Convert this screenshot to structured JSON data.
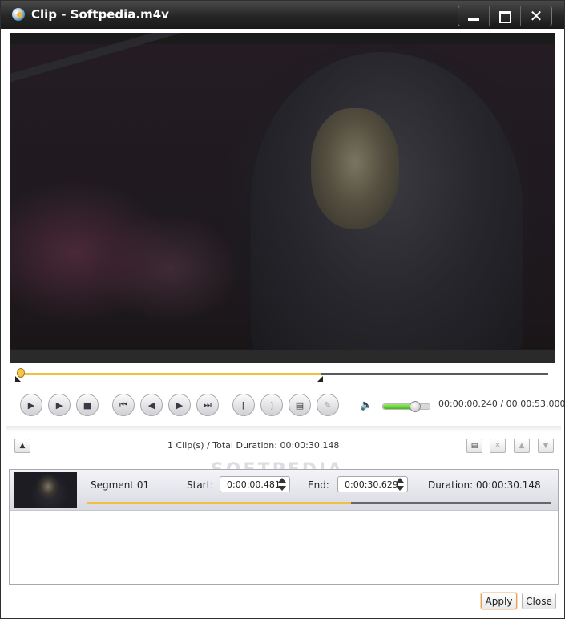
{
  "window": {
    "title": "Clip - Softpedia.m4v",
    "minimize_icon": "minimize-icon",
    "maximize_icon": "maximize-icon",
    "close_icon": "close-icon",
    "close_glyph": "✕"
  },
  "player": {
    "seek_progress": 0.573,
    "segment_end_fraction": 0.573,
    "controls": [
      {
        "name": "play-button",
        "icon": "play-icon",
        "glyph": "▶"
      },
      {
        "name": "play-segment-button",
        "icon": "play-segment-icon",
        "glyph": "▶"
      },
      {
        "name": "stop-button",
        "icon": "stop-icon",
        "glyph": "■"
      },
      {
        "name": "skip-to-start-button",
        "icon": "skip-start-icon",
        "glyph": "⏮"
      },
      {
        "name": "step-back-button",
        "icon": "step-back-icon",
        "glyph": "◀"
      },
      {
        "name": "step-forward-button",
        "icon": "step-forward-icon",
        "glyph": "▶"
      },
      {
        "name": "skip-to-end-button",
        "icon": "skip-end-icon",
        "glyph": "⏭"
      },
      {
        "name": "set-start-button",
        "icon": "bracket-open-icon",
        "glyph": "["
      },
      {
        "name": "set-end-button",
        "icon": "bracket-close-icon",
        "glyph": "]"
      },
      {
        "name": "add-clip-button",
        "icon": "add-document-icon",
        "glyph": "▤"
      },
      {
        "name": "edit-button",
        "icon": "pencil-icon",
        "glyph": "✎"
      }
    ],
    "volume_icon": "speaker-icon",
    "volume_glyph": "🔈",
    "volume_level": 0.68,
    "time_display": "00:00:00.240 / 00:00:53.000"
  },
  "clip_bar": {
    "collapse_icon": "triangle-up-icon",
    "collapse_glyph": "▲",
    "summary": "1 Clip(s) /  Total Duration: 00:00:30.148",
    "actions": [
      {
        "name": "new-clip-button",
        "icon": "new-document-icon",
        "glyph": "▤"
      },
      {
        "name": "delete-clip-button",
        "icon": "x-icon",
        "glyph": "✕"
      },
      {
        "name": "move-up-button",
        "icon": "triangle-up-icon",
        "glyph": "▲"
      },
      {
        "name": "move-down-button",
        "icon": "triangle-down-icon",
        "glyph": "▼"
      }
    ]
  },
  "watermark": "SOFTPEDIA",
  "segments": [
    {
      "name": "Segment 01",
      "start_label": "Start:",
      "start": "0:00:00.481",
      "end_label": "End:",
      "end": "0:00:30.629",
      "duration": "Duration: 00:00:30.148",
      "progress": 0.57
    }
  ],
  "footer": {
    "apply_label": "Apply",
    "close_label": "Close"
  },
  "colors": {
    "accent": "#f2c040",
    "volume": "#42b81a",
    "titlebar": "#262626"
  }
}
